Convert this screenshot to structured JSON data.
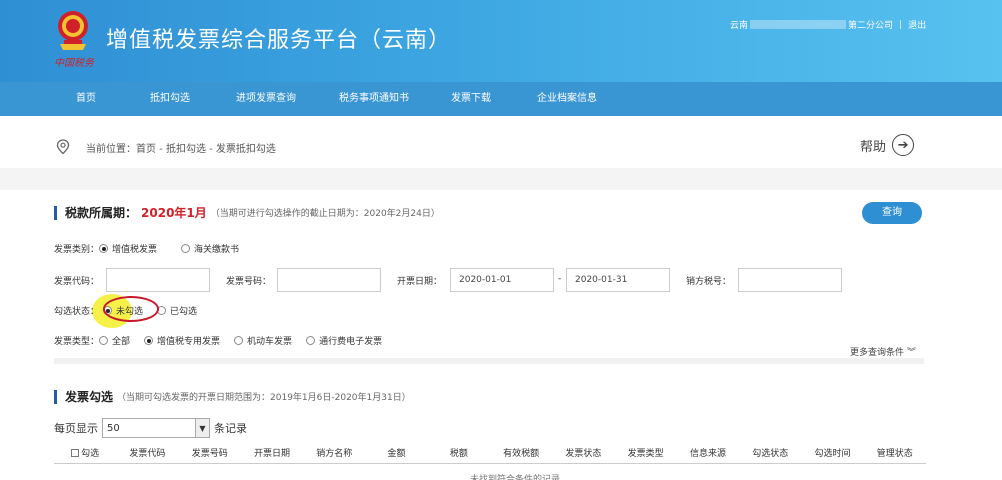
{
  "header": {
    "title": "增值税发票综合服务平台（云南）",
    "brand_sub": "中国税务",
    "user_prefix": "云南",
    "user_company": "第二分公司",
    "logout": "退出"
  },
  "nav": {
    "items": [
      {
        "label": "首页"
      },
      {
        "label": "抵扣勾选"
      },
      {
        "label": "进项发票查询"
      },
      {
        "label": "税务事项通知书"
      },
      {
        "label": "发票下载"
      },
      {
        "label": "企业档案信息"
      }
    ]
  },
  "breadcrumb": {
    "text": "当前位置：首页 - 抵扣勾选 - 发票抵扣勾选",
    "help": "帮助"
  },
  "period": {
    "label": "税款所属期：",
    "value": "2020年1月",
    "note": "（当期可进行勾选操作的截止日期为：2020年2月24日）",
    "query_button": "查询"
  },
  "form": {
    "invoice_kind_label": "发票类别：",
    "invoice_kind_options": [
      {
        "label": "增值税发票",
        "checked": true
      },
      {
        "label": "海关缴款书",
        "checked": false
      }
    ],
    "code_label": "发票代码：",
    "code_value": "",
    "number_label": "发票号码：",
    "number_value": "",
    "date_label": "开票日期：",
    "date_from": "2020-01-01",
    "date_sep": "-",
    "date_to": "2020-01-31",
    "seller_tax_label": "销方税号：",
    "seller_tax_value": "",
    "select_status_label": "勾选状态：",
    "select_status_options": [
      {
        "label": "未勾选",
        "checked": true
      },
      {
        "label": "已勾选",
        "checked": false
      }
    ],
    "invoice_type_label": "发票类型：",
    "invoice_type_options": [
      {
        "label": "全部",
        "checked": false
      },
      {
        "label": "增值税专用发票",
        "checked": true
      },
      {
        "label": "机动车发票",
        "checked": false
      },
      {
        "label": "通行费电子发票",
        "checked": false
      }
    ],
    "more_conditions": "更多查询条件"
  },
  "selection": {
    "title": "发票勾选",
    "note": "（当期可勾选发票的开票日期范围为：2019年1月6日-2020年1月31日）",
    "per_page_label": "每页显示",
    "per_page_value": "50",
    "records_label": "条记录",
    "columns": [
      "勾选",
      "发票代码",
      "发票号码",
      "开票日期",
      "销方名称",
      "金额",
      "税额",
      "有效税额",
      "发票状态",
      "发票类型",
      "信息来源",
      "勾选状态",
      "勾选时间",
      "管理状态"
    ],
    "empty_text": "未找到符合条件的记录"
  },
  "colors": {
    "header_start": "#2f8fd3",
    "header_end": "#57c1ef",
    "nav": "#3a95d3",
    "accent_red": "#d0202a",
    "button": "#2f8fd3"
  },
  "icons": {
    "emblem": "tax-emblem-icon",
    "location": "location-pin-icon",
    "help": "arrow-right-circle-icon",
    "chevron": "chevron-down-icon"
  }
}
